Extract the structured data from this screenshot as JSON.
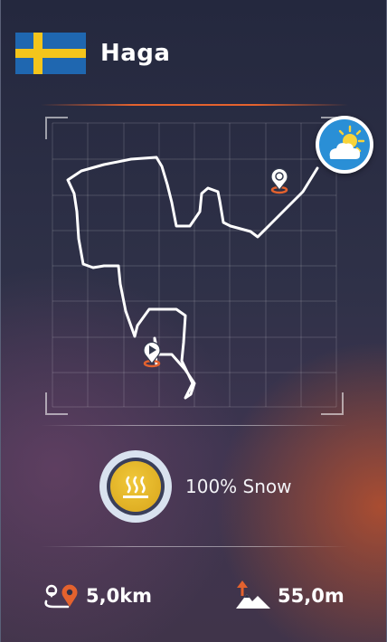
{
  "header": {
    "title": "Haga",
    "flag": "sweden-flag"
  },
  "map": {
    "start_marker": "play-icon",
    "end_marker": "flag-icon"
  },
  "weather": {
    "icon": "sun-cloud-icon"
  },
  "snow": {
    "icon": "snow-cannon-icon",
    "label": "100% Snow"
  },
  "stats": {
    "distance": {
      "icon": "route-distance-icon",
      "value": "5,0km"
    },
    "elevation": {
      "icon": "elevation-icon",
      "value": "55,0m"
    }
  },
  "colors": {
    "accent": "#e4622e",
    "flag_blue": "#1f67b0",
    "flag_yellow": "#f4c51b",
    "badge_gold": "#e1b22a",
    "weather_blue": "#2a8fd6"
  }
}
